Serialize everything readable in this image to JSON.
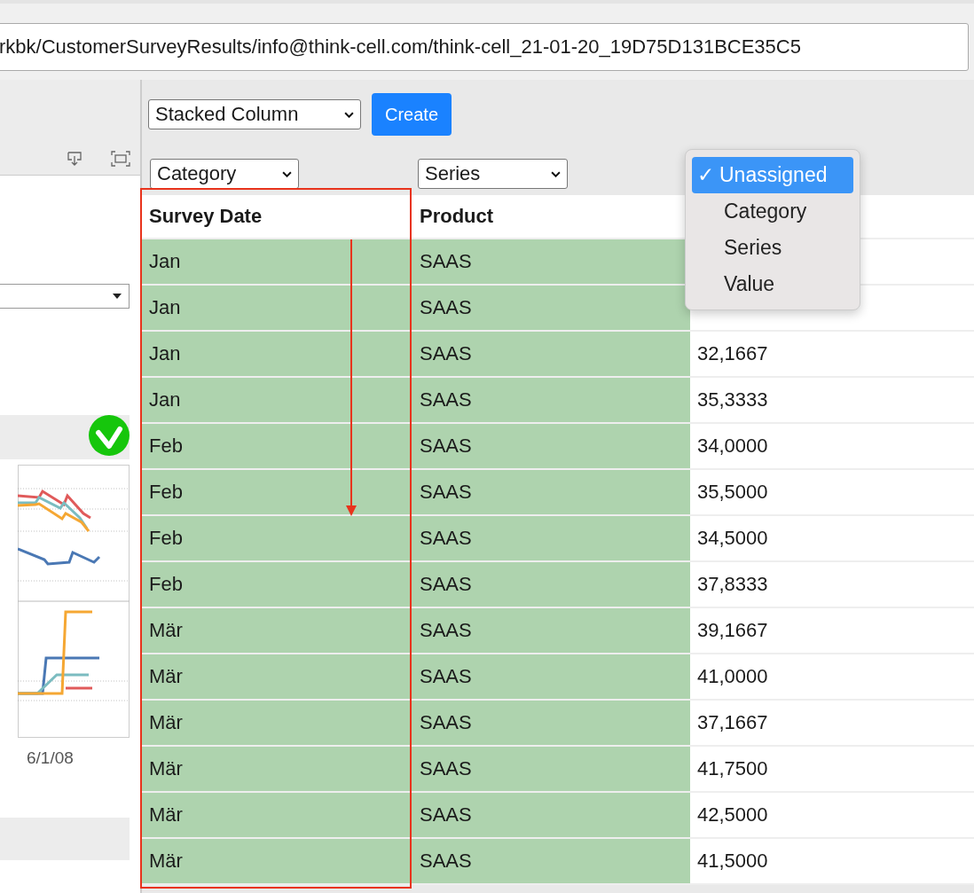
{
  "address_bar": {
    "value": "rkbk/CustomerSurveyResults/info@think-cell.com/think-cell_21-01-20_19D75D131BCE35C5"
  },
  "side_panel": {
    "status_ok": true,
    "axis_label": "6/1/08"
  },
  "chart_type_select": {
    "value": "Stacked Column"
  },
  "create_button": {
    "label": "Create"
  },
  "column_role_selects": [
    {
      "value": "Category"
    },
    {
      "value": "Series"
    }
  ],
  "role_menu": {
    "options": [
      {
        "label": "Unassigned",
        "selected": true,
        "check": "✓"
      },
      {
        "label": "Category",
        "selected": false
      },
      {
        "label": "Series",
        "selected": false
      },
      {
        "label": "Value",
        "selected": false
      }
    ]
  },
  "table": {
    "columns": [
      {
        "label": "Survey Date",
        "highlighted": true
      },
      {
        "label": "Product",
        "highlighted": true
      },
      {
        "highlighted": false
      }
    ],
    "rows": [
      {
        "cells": [
          "Jan",
          "SAAS"
        ]
      },
      {
        "cells": [
          "Jan",
          "SAAS"
        ]
      },
      {
        "cells": [
          "Jan",
          "SAAS",
          "32,1667"
        ]
      },
      {
        "cells": [
          "Jan",
          "SAAS",
          "35,3333"
        ]
      },
      {
        "cells": [
          "Feb",
          "SAAS",
          "34,0000"
        ]
      },
      {
        "cells": [
          "Feb",
          "SAAS",
          "35,5000"
        ]
      },
      {
        "cells": [
          "Feb",
          "SAAS",
          "34,5000"
        ]
      },
      {
        "cells": [
          "Feb",
          "SAAS",
          "37,8333"
        ]
      },
      {
        "cells": [
          "Mär",
          "SAAS",
          "39,1667"
        ]
      },
      {
        "cells": [
          "Mär",
          "SAAS",
          "41,0000"
        ]
      },
      {
        "cells": [
          "Mär",
          "SAAS",
          "37,1667"
        ]
      },
      {
        "cells": [
          "Mär",
          "SAAS",
          "41,7500"
        ]
      },
      {
        "cells": [
          "Mär",
          "SAAS",
          "42,5000"
        ]
      },
      {
        "cells": [
          "Mär",
          "SAAS",
          "41,5000"
        ]
      }
    ]
  }
}
